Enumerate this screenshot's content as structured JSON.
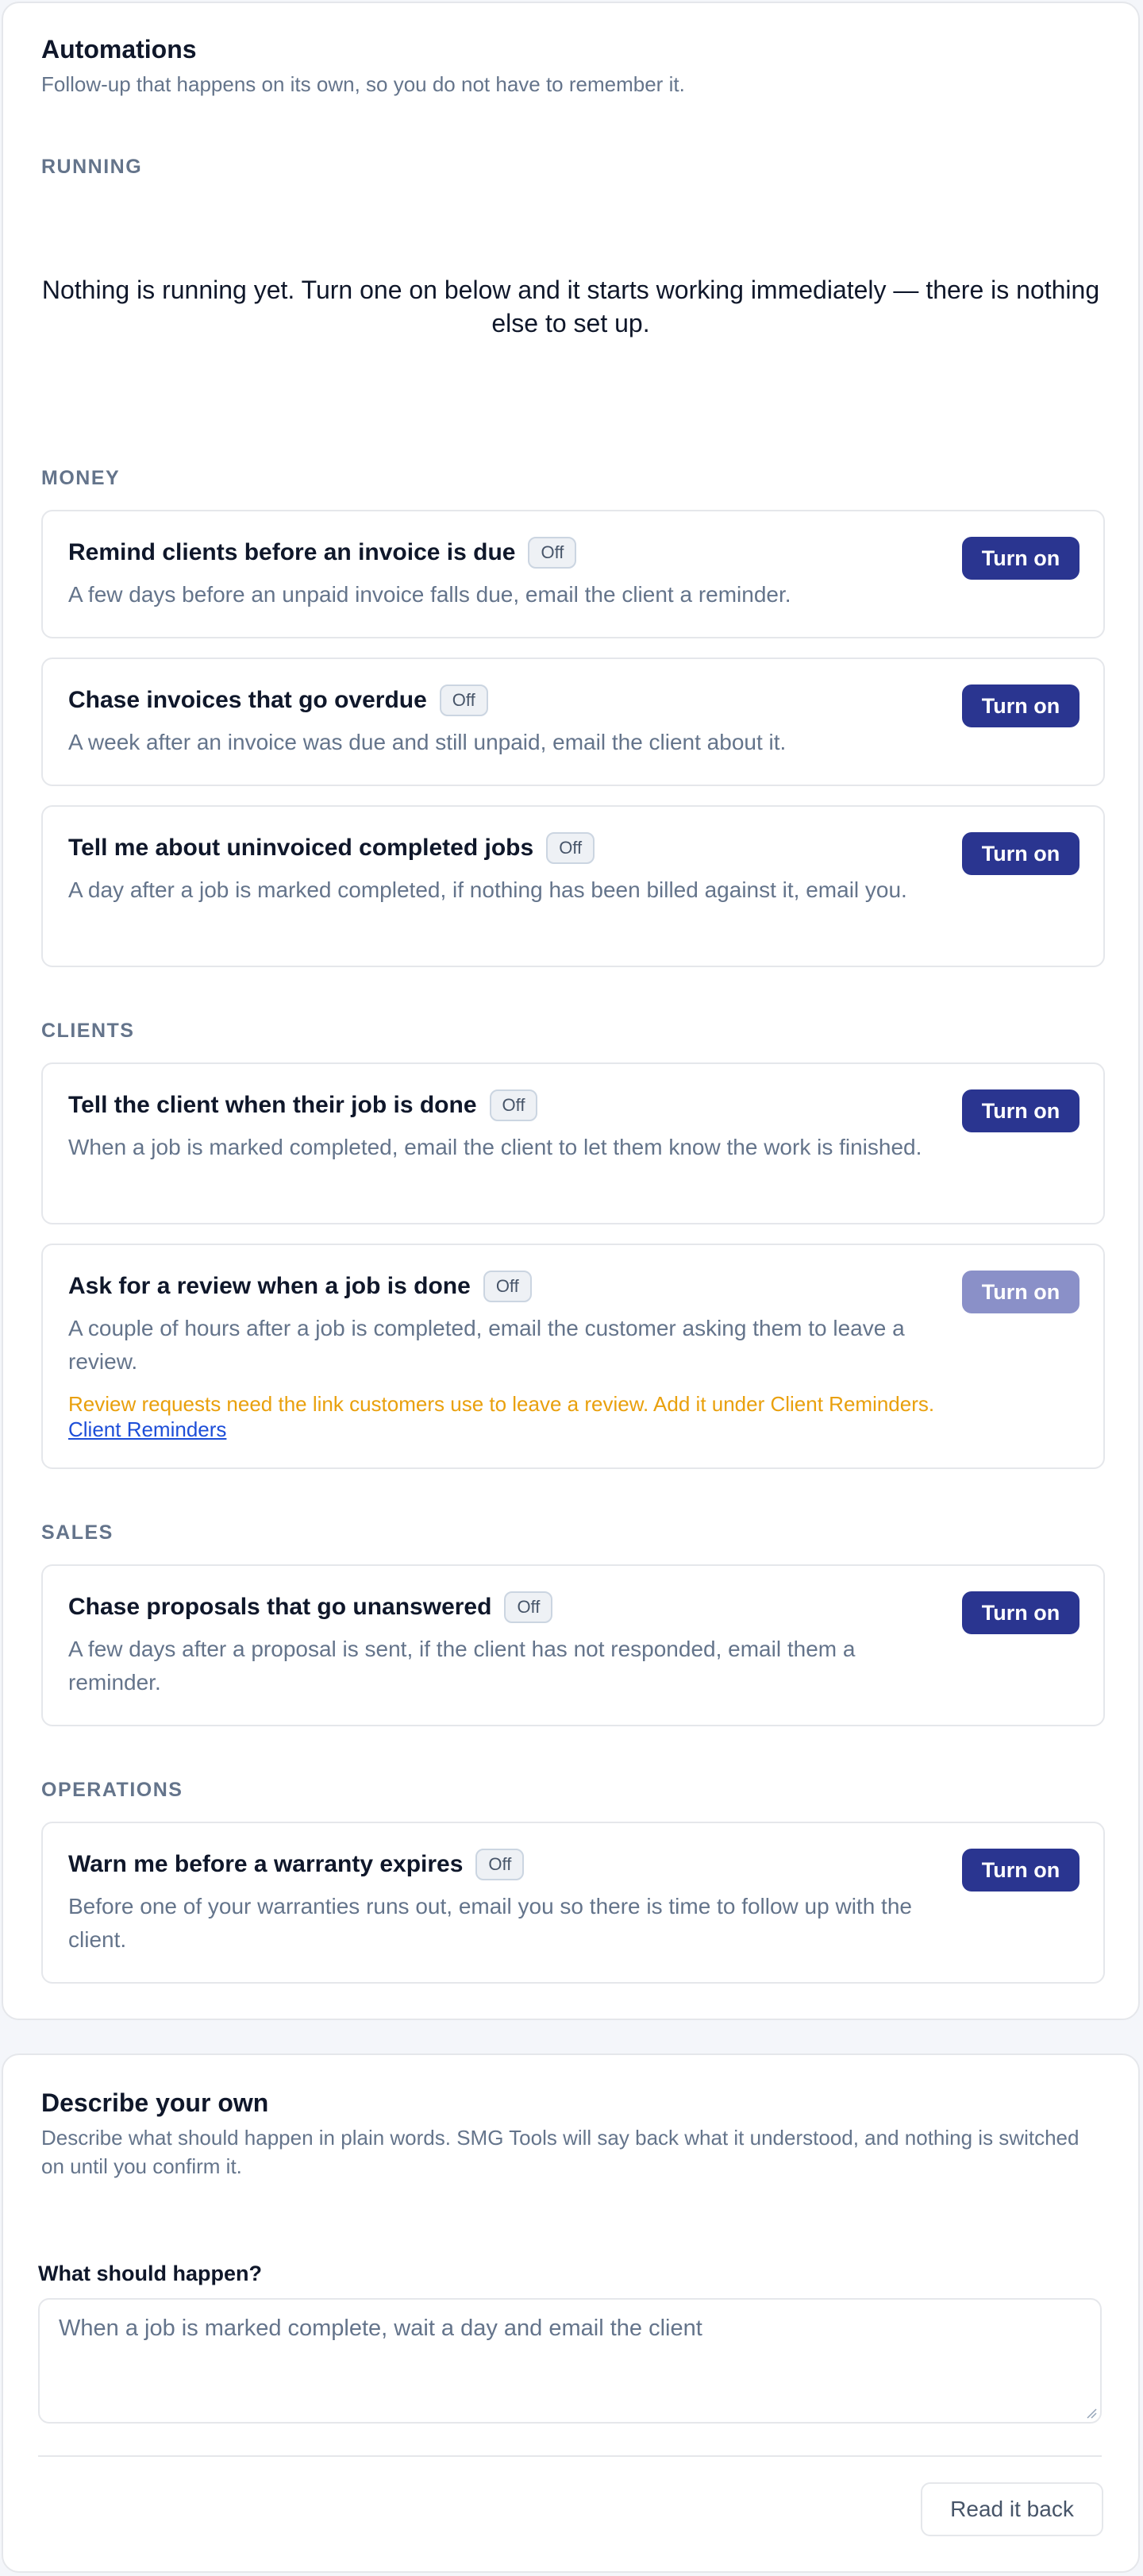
{
  "automations": {
    "title": "Automations",
    "subtitle": "Follow-up that happens on its own, so you do not have to remember it.",
    "running_label": "RUNNING",
    "running_empty": "Nothing is running yet. Turn one on below and it starts working immediately — there is nothing else to set up.",
    "sections": [
      {
        "label": "MONEY",
        "items": [
          {
            "title": "Remind clients before an invoice is due",
            "status": "Off",
            "description": "A few days before an unpaid invoice falls due, email the client a reminder.",
            "action": "Turn on"
          },
          {
            "title": "Chase invoices that go overdue",
            "status": "Off",
            "description": "A week after an invoice was due and still unpaid, email the client about it.",
            "action": "Turn on"
          },
          {
            "title": "Tell me about uninvoiced completed jobs",
            "status": "Off",
            "description": "A day after a job is marked completed, if nothing has been billed against it, email you.",
            "action": "Turn on"
          }
        ]
      },
      {
        "label": "CLIENTS",
        "items": [
          {
            "title": "Tell the client when their job is done",
            "status": "Off",
            "description": "When a job is marked completed, email the client to let them know the work is finished.",
            "action": "Turn on"
          },
          {
            "title": "Ask for a review when a job is done",
            "status": "Off",
            "description": "A couple of hours after a job is completed, email the customer asking them to leave a review.",
            "action": "Turn on",
            "disabled": true,
            "warning": "Review requests need the link customers use to leave a review. Add it under Client Reminders.",
            "warning_link": "Client Reminders"
          }
        ]
      },
      {
        "label": "SALES",
        "items": [
          {
            "title": "Chase proposals that go unanswered",
            "status": "Off",
            "description": "A few days after a proposal is sent, if the client has not responded, email them a reminder.",
            "action": "Turn on"
          }
        ]
      },
      {
        "label": "OPERATIONS",
        "items": [
          {
            "title": "Warn me before a warranty expires",
            "status": "Off",
            "description": "Before one of your warranties runs out, email you so there is time to follow up with the client.",
            "action": "Turn on"
          }
        ]
      }
    ]
  },
  "describe": {
    "title": "Describe your own",
    "subtitle": "Describe what should happen in plain words. SMG Tools will say back what it understood, and nothing is switched on until you confirm it.",
    "field_label": "What should happen?",
    "placeholder": "When a job is marked complete, wait a day and email the client",
    "read_back": "Read it back"
  },
  "colors": {
    "primary": "#2a3590",
    "primary_disabled": "#8a90c8",
    "warning": "#e9a00d",
    "link": "#1d4ed8"
  }
}
